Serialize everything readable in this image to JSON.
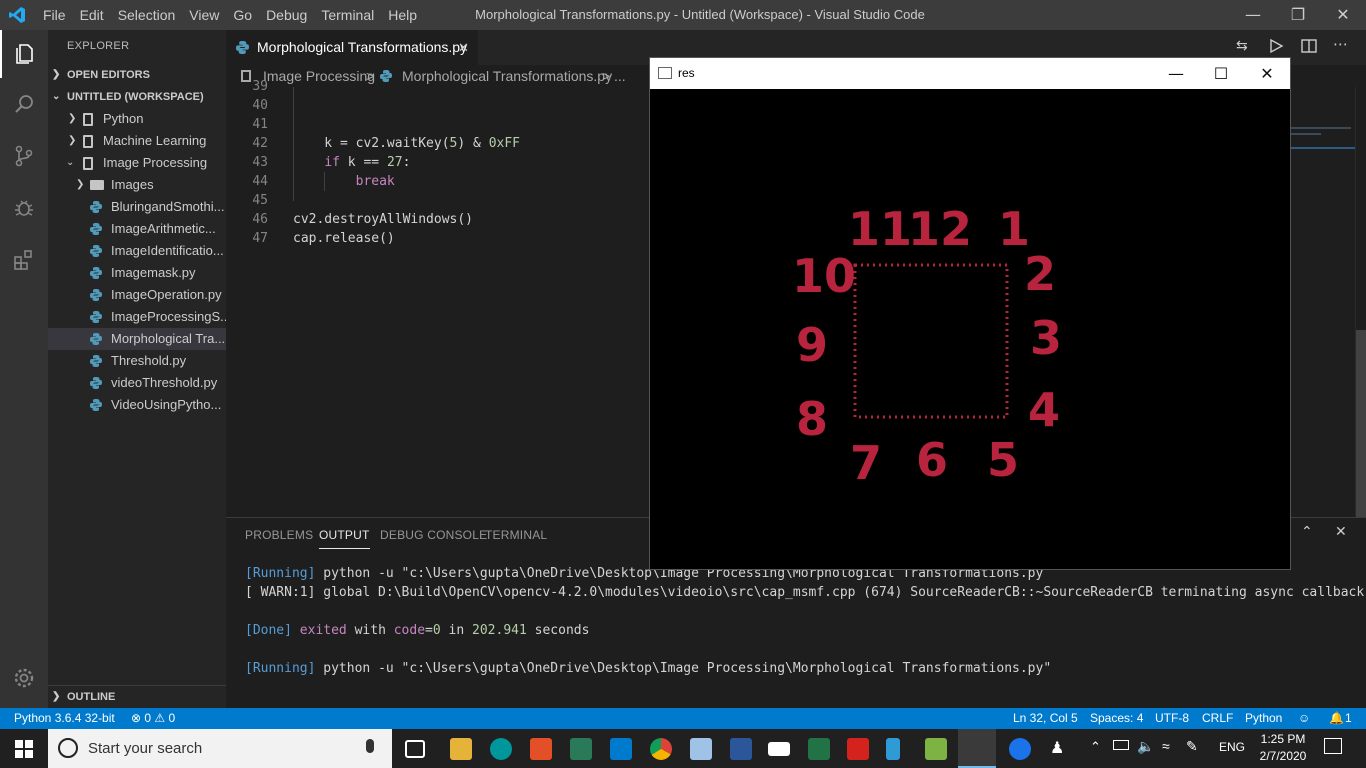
{
  "titlebar": {
    "menu": [
      "File",
      "Edit",
      "Selection",
      "View",
      "Go",
      "Debug",
      "Terminal",
      "Help"
    ],
    "title": "Morphological Transformations.py - Untitled (Workspace) - Visual Studio Code"
  },
  "sidebar": {
    "header": "EXPLORER",
    "open_editors": "OPEN EDITORS",
    "workspace": "UNTITLED (WORKSPACE)",
    "items": [
      {
        "label": "Python",
        "kind": "root"
      },
      {
        "label": "Machine Learning",
        "kind": "root"
      },
      {
        "label": "Image Processing",
        "kind": "root"
      },
      {
        "label": "Images",
        "kind": "folder"
      },
      {
        "label": "BluringandSmothi...",
        "kind": "file"
      },
      {
        "label": "ImageArithmetic...",
        "kind": "file"
      },
      {
        "label": "ImageIdentificatio...",
        "kind": "file"
      },
      {
        "label": "Imagemask.py",
        "kind": "file"
      },
      {
        "label": "ImageOperation.py",
        "kind": "file"
      },
      {
        "label": "ImageProcessingS...",
        "kind": "file"
      },
      {
        "label": "Morphological Tra...",
        "kind": "file"
      },
      {
        "label": "Threshold.py",
        "kind": "file"
      },
      {
        "label": "videoThreshold.py",
        "kind": "file"
      },
      {
        "label": "VideoUsingPytho...",
        "kind": "file"
      }
    ],
    "outline": "OUTLINE"
  },
  "editor": {
    "tab": "Morphological Transformations.py",
    "breadcrumb": [
      "Image Processing",
      "Morphological Transformations.py",
      "..."
    ],
    "lines": [
      {
        "n": "40",
        "text": ""
      },
      {
        "n": "41",
        "text": ""
      },
      {
        "n": "42",
        "text": "    k = cv2.waitKey(5) & 0xFF"
      },
      {
        "n": "43",
        "text": "    if k == 27:"
      },
      {
        "n": "44",
        "text": "        break"
      },
      {
        "n": "45",
        "text": ""
      },
      {
        "n": "46",
        "text": "cv2.destroyAllWindows()"
      },
      {
        "n": "47",
        "text": "cap.release()"
      }
    ]
  },
  "panel": {
    "tabs": [
      "PROBLEMS",
      "OUTPUT",
      "DEBUG CONSOLE",
      "TERMINAL"
    ],
    "active_tab": "OUTPUT",
    "output": [
      {
        "tag": "[Running]",
        "rest": " python -u \"c:\\Users\\gupta\\OneDrive\\Desktop\\Image Processing\\Morphological Transformations.py"
      },
      {
        "tag": "",
        "rest": "[ WARN:1] global D:\\Build\\OpenCV\\opencv-4.2.0\\modules\\videoio\\src\\cap_msmf.cpp (674) SourceReaderCB::~SourceReaderCB terminating async callback"
      },
      {
        "tag": "[Done]",
        "rest": " exited with code=0 in 202.941 seconds"
      },
      {
        "tag": "[Running]",
        "rest": " python -u \"c:\\Users\\gupta\\OneDrive\\Desktop\\Image Processing\\Morphological Transformations.py\""
      }
    ]
  },
  "res_window": {
    "title": "res",
    "numbers": [
      "11",
      "12",
      "1",
      "2",
      "3",
      "4",
      "5",
      "6",
      "7",
      "8",
      "9",
      "10"
    ],
    "color": "#b8243e"
  },
  "status": {
    "interpreter": "Python 3.6.4 32-bit",
    "problems": "⊗ 0 ⚠ 0",
    "position": "Ln 32, Col 5",
    "spaces": "Spaces: 4",
    "encoding": "UTF-8",
    "eol": "CRLF",
    "language": "Python",
    "notifications": "1"
  },
  "taskbar": {
    "search_placeholder": "Start your search",
    "lang": "ENG",
    "time": "1:25 PM",
    "date": "2/7/2020"
  },
  "colors": {
    "accent": "#007acc",
    "sidebar_bg": "#252526",
    "editor_bg": "#1e1e1e"
  }
}
